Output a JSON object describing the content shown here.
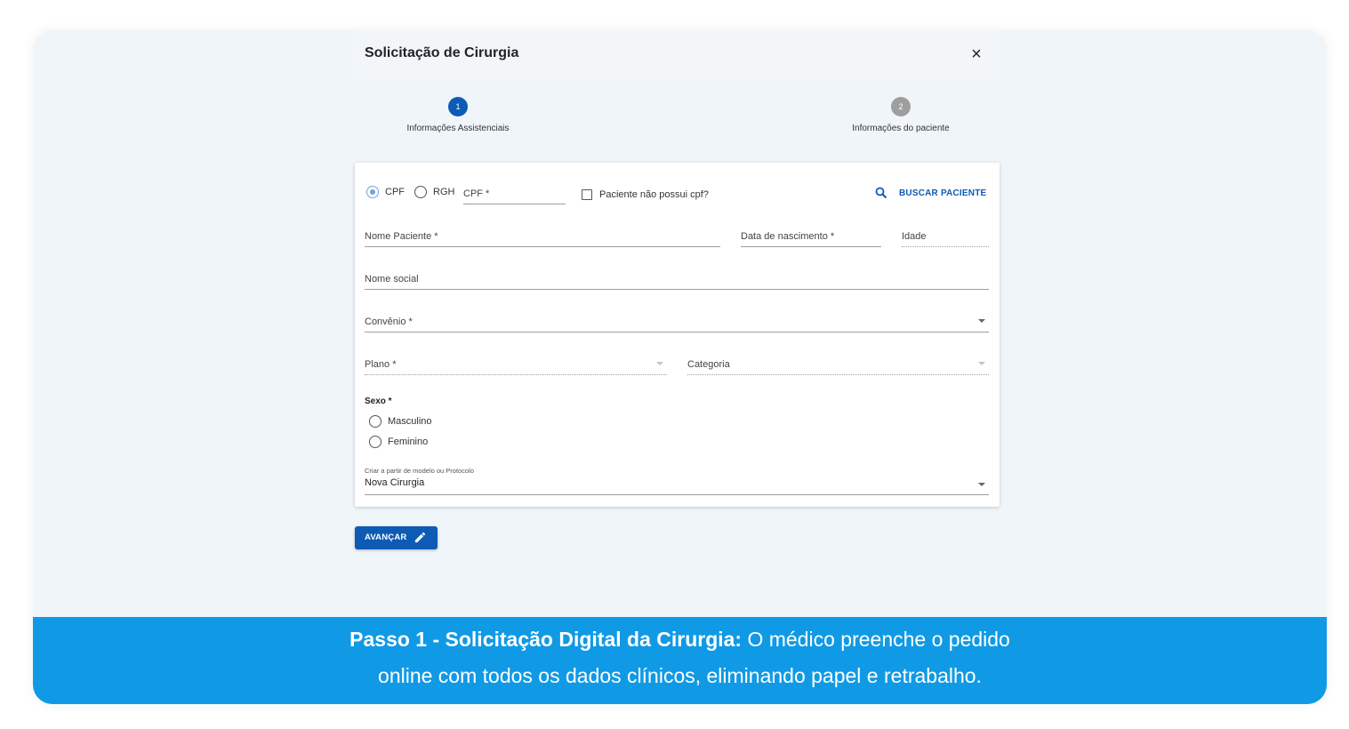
{
  "dialog": {
    "title": "Solicitação de Cirurgia",
    "close_icon": "close-icon"
  },
  "steps": [
    {
      "number": "1",
      "label": "Informações Assistenciais",
      "active": true,
      "color": "#0d5bb5"
    },
    {
      "number": "2",
      "label": "Informações do paciente",
      "active": false,
      "color": "#9e9e9e"
    }
  ],
  "form": {
    "doc_type": {
      "options": [
        "CPF",
        "RGH"
      ],
      "selected": "CPF"
    },
    "cpf_placeholder": "CPF *",
    "no_cpf_label": "Paciente não possui cpf?",
    "search_button": "BUSCAR PACIENTE",
    "nome_paciente": "Nome Paciente *",
    "data_nascimento": "Data de nascimento *",
    "idade": "Idade",
    "nome_social": "Nome social",
    "convenio": "Convênio *",
    "plano": "Plano *",
    "categoria": "Categoria",
    "sexo": {
      "title": "Sexo *",
      "options": [
        "Masculino",
        "Feminino"
      ]
    },
    "modelo": {
      "caption": "Criar a partir de modelo ou Protocolo",
      "value": "Nova Cirurgia"
    }
  },
  "advance_button": "AVANÇAR",
  "banner": {
    "bold": "Passo 1 - Solicitação Digital da Cirurgia:",
    "line1_rest": " O médico preenche o pedido",
    "line2": "online com todos os dados clínicos, eliminando papel e retrabalho."
  },
  "colors": {
    "primary": "#0d5bb5",
    "banner": "#109ae5",
    "background": "#f0f5f9"
  }
}
